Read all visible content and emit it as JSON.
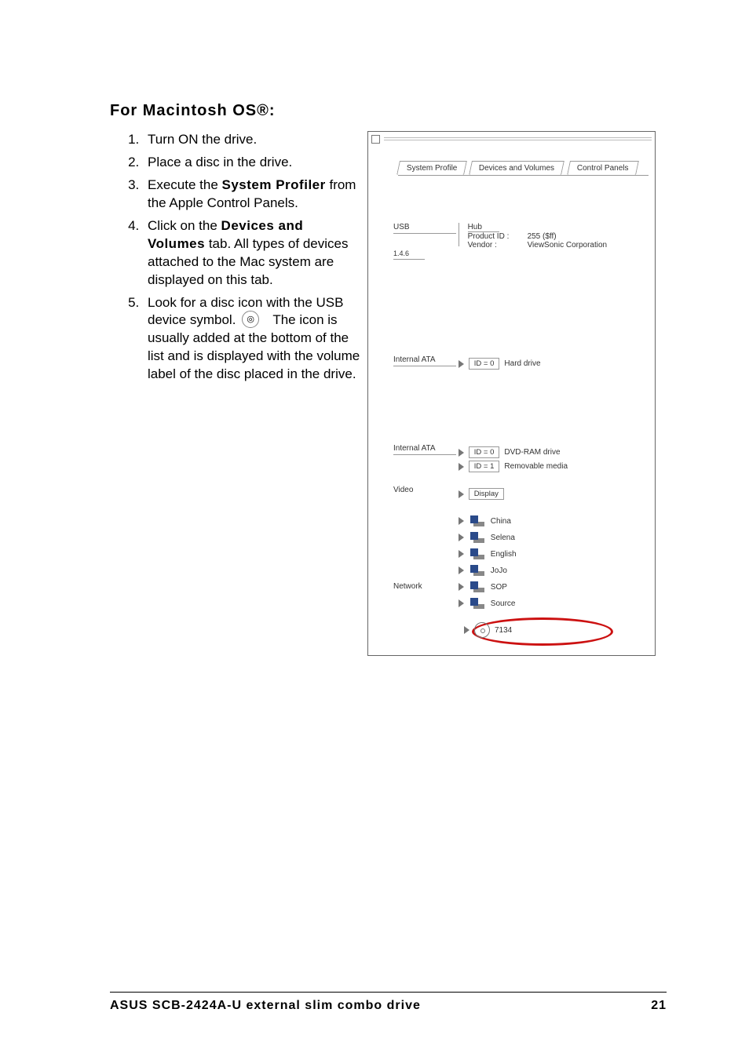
{
  "heading": "For Macintosh OS®:",
  "steps": {
    "s1": "Turn ON the drive.",
    "s2": "Place a disc in the drive.",
    "s3_a": "Execute the ",
    "s3_b": "System Profiler",
    "s3_c": " from the Apple Control Panels.",
    "s4_a": "Click on the ",
    "s4_b": "Devices and Volumes",
    "s4_c": " tab. All types of devices attached to the Mac system are displayed on this tab.",
    "s5_a": "Look for a disc icon with the USB device symbol.",
    "s5_b": "The icon is usually added at the bottom of the list and is displayed with the volume label of the disc placed in the drive."
  },
  "shot": {
    "tabs": {
      "t1": "System Profile",
      "t2": "Devices and Volumes",
      "t3": "Control Panels"
    },
    "usb": {
      "label": "USB",
      "version": "1.4.6",
      "hub": "Hub",
      "productIdLabel": "Product ID :",
      "productIdValue": "255 ($ff)",
      "vendorLabel": "Vendor :",
      "vendorValue": "ViewSonic Corporation"
    },
    "ata1": {
      "label": "Internal ATA",
      "id": "ID = 0",
      "device": "Hard drive"
    },
    "ata2": {
      "label": "Internal ATA",
      "id0": "ID = 0",
      "dev0": "DVD-RAM drive",
      "id1": "ID = 1",
      "dev1": "Removable media"
    },
    "video": {
      "label": "Video",
      "display": "Display"
    },
    "network": {
      "label": "Network",
      "items": [
        "China",
        "Selena",
        "English",
        "JoJo",
        "SOP",
        "Source"
      ]
    },
    "discVolume": "7134"
  },
  "footer": {
    "left": "ASUS SCB-2424A-U external slim combo drive",
    "right": "21"
  }
}
